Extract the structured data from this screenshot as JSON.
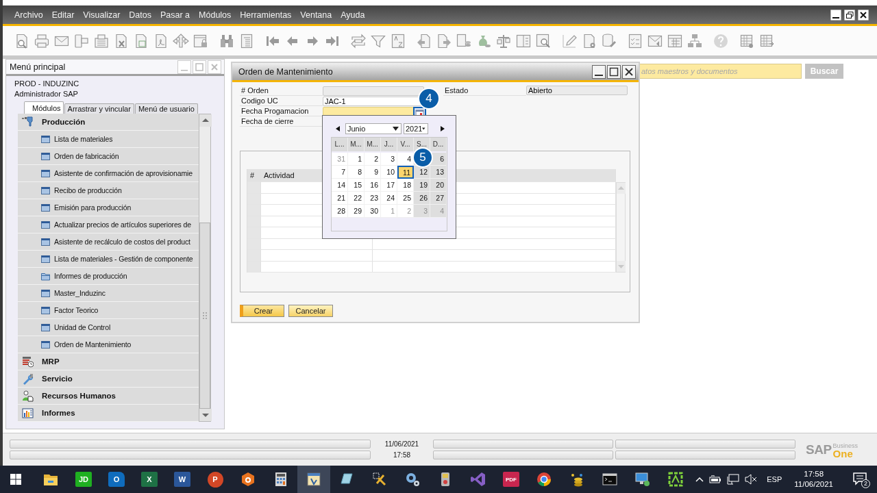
{
  "menu_bar": {
    "items": [
      "Archivo",
      "Editar",
      "Visualizar",
      "Datos",
      "Pasar a",
      "Módulos",
      "Herramientas",
      "Ventana",
      "Ayuda"
    ]
  },
  "search": {
    "placeholder": "atos maestros y documentos",
    "button": "Buscar"
  },
  "main_menu": {
    "title": "Menú principal",
    "company": "PROD - INDUZINC",
    "user": "Administrador SAP",
    "tabs": [
      {
        "label": "Módulos",
        "selected": true
      },
      {
        "label": "Arrastrar y vincular",
        "selected": false
      },
      {
        "label": "Menú de usuario",
        "selected": false
      }
    ],
    "modules": [
      {
        "label": "Producción",
        "children": [
          {
            "label": "Lista de materiales",
            "kind": "form"
          },
          {
            "label": "Orden de fabricación",
            "kind": "form"
          },
          {
            "label": "Asistente de confirmación de aprovisionamie",
            "kind": "form"
          },
          {
            "label": "Recibo de producción",
            "kind": "form"
          },
          {
            "label": "Emisión para producción",
            "kind": "form"
          },
          {
            "label": "Actualizar precios de artículos superiores de",
            "kind": "form"
          },
          {
            "label": "Asistente de recálculo de costos del product",
            "kind": "form"
          },
          {
            "label": "Lista de materiales - Gestión de componente",
            "kind": "form"
          },
          {
            "label": "Informes de producción",
            "kind": "folder"
          },
          {
            "label": "Master_Induzinc",
            "kind": "form"
          },
          {
            "label": "Factor Teorico",
            "kind": "form"
          },
          {
            "label": "Unidad de Control",
            "kind": "form"
          },
          {
            "label": "Orden de Mantenimiento",
            "kind": "form"
          }
        ]
      },
      {
        "label": "MRP"
      },
      {
        "label": "Servicio"
      },
      {
        "label": "Recursos Humanos"
      },
      {
        "label": "Informes"
      }
    ]
  },
  "dialog": {
    "title": "Orden de Mantenimiento",
    "fields": [
      {
        "label": "# Orden",
        "kind": "readonly"
      },
      {
        "label": "Codigo UC",
        "kind": "text",
        "value": "JAC-1"
      },
      {
        "label": "Fecha Progamacion",
        "kind": "date"
      },
      {
        "label": "Fecha de cierre"
      }
    ],
    "side_fields": [
      {
        "label": "Estado",
        "kind": "readonly",
        "value": "Abierto"
      }
    ],
    "table": {
      "columns": [
        "#",
        "Actividad"
      ]
    },
    "buttons": [
      {
        "label": "Crear",
        "kind": "primary"
      },
      {
        "label": "Cancelar",
        "kind": "normal"
      }
    ]
  },
  "calendar": {
    "month": "Junio",
    "year": "2021",
    "weekdays": [
      "L...",
      "M...",
      "M...",
      "J...",
      "V...",
      "S...",
      "D..."
    ],
    "weeks": [
      [
        {
          "day": "31",
          "outside": true,
          "selected": false
        },
        {
          "day": "1",
          "outside": false,
          "selected": false
        },
        {
          "day": "2",
          "outside": false,
          "selected": false
        },
        {
          "day": "3",
          "outside": false,
          "selected": false
        },
        {
          "day": "4",
          "outside": false,
          "selected": false
        },
        {
          "callout": "5"
        },
        {
          "day": "6",
          "outside": false,
          "selected": false
        }
      ],
      [
        {
          "day": "7",
          "outside": false,
          "selected": false
        },
        {
          "day": "8",
          "outside": false,
          "selected": false
        },
        {
          "day": "9",
          "outside": false,
          "selected": false
        },
        {
          "day": "10",
          "outside": false,
          "selected": false
        },
        {
          "day": "11",
          "outside": false,
          "selected": true
        },
        {
          "day": "12",
          "outside": false,
          "selected": false
        },
        {
          "day": "13",
          "outside": false,
          "selected": false
        }
      ],
      [
        {
          "day": "14",
          "outside": false,
          "selected": false
        },
        {
          "day": "15",
          "outside": false,
          "selected": false
        },
        {
          "day": "16",
          "outside": false,
          "selected": false
        },
        {
          "day": "17",
          "outside": false,
          "selected": false
        },
        {
          "day": "18",
          "outside": false,
          "selected": false
        },
        {
          "day": "19",
          "outside": false,
          "selected": false
        },
        {
          "day": "20",
          "outside": false,
          "selected": false
        }
      ],
      [
        {
          "day": "21",
          "outside": false,
          "selected": false
        },
        {
          "day": "22",
          "outside": false,
          "selected": false
        },
        {
          "day": "23",
          "outside": false,
          "selected": false
        },
        {
          "day": "24",
          "outside": false,
          "selected": false
        },
        {
          "day": "25",
          "outside": false,
          "selected": false
        },
        {
          "day": "26",
          "outside": false,
          "selected": false
        },
        {
          "day": "27",
          "outside": false,
          "selected": false
        }
      ],
      [
        {
          "day": "28",
          "outside": false,
          "selected": false
        },
        {
          "day": "29",
          "outside": false,
          "selected": false
        },
        {
          "day": "30",
          "outside": false,
          "selected": false
        },
        {
          "day": "1",
          "outside": true,
          "selected": false
        },
        {
          "day": "2",
          "outside": true,
          "selected": false
        },
        {
          "day": "3",
          "outside": true,
          "selected": false
        },
        {
          "day": "4",
          "outside": true,
          "selected": false
        }
      ]
    ]
  },
  "callouts": [
    "4"
  ],
  "status_bar": {
    "date": "11/06/2021",
    "time": "17:58",
    "logo": {
      "name": "SAP",
      "line1": "Business",
      "line2": "One"
    }
  },
  "taskbar": {
    "apps": [
      {
        "kind": "folder",
        "active": false
      },
      {
        "kind": "tile",
        "glyph": "JD",
        "color": "#1fb021",
        "active": false
      },
      {
        "kind": "mail",
        "glyph": "O",
        "color": "#0f6cbd",
        "active": false
      },
      {
        "kind": "tile",
        "glyph": "X",
        "color": "#1e7145",
        "active": false
      },
      {
        "kind": "tile",
        "glyph": "W",
        "color": "#2b579a",
        "active": false
      },
      {
        "kind": "round",
        "glyph": "P",
        "color": "#d24726",
        "active": false
      },
      {
        "kind": "hex",
        "color": "#e8731f",
        "active": false
      },
      {
        "kind": "calculator",
        "active": false
      },
      {
        "kind": "window",
        "active": true
      },
      {
        "kind": "glass",
        "active": false
      },
      {
        "kind": "tools",
        "active": false
      },
      {
        "kind": "gear",
        "active": false
      },
      {
        "kind": "phone",
        "active": false
      },
      {
        "kind": "ribbon",
        "color": "#865fc5",
        "active": false
      },
      {
        "kind": "tile",
        "glyph": "PDF",
        "color": "#c8264f",
        "active": false
      },
      {
        "kind": "chrome",
        "active": false
      },
      {
        "kind": "stack",
        "active": false
      },
      {
        "kind": "terminal",
        "active": false
      },
      {
        "kind": "monitor",
        "active": false
      },
      {
        "kind": "frame",
        "color": "#7fd13b",
        "active": false
      }
    ],
    "language": "ESP",
    "time": "17:58",
    "date": "11/06/2021",
    "notifications": "2"
  }
}
